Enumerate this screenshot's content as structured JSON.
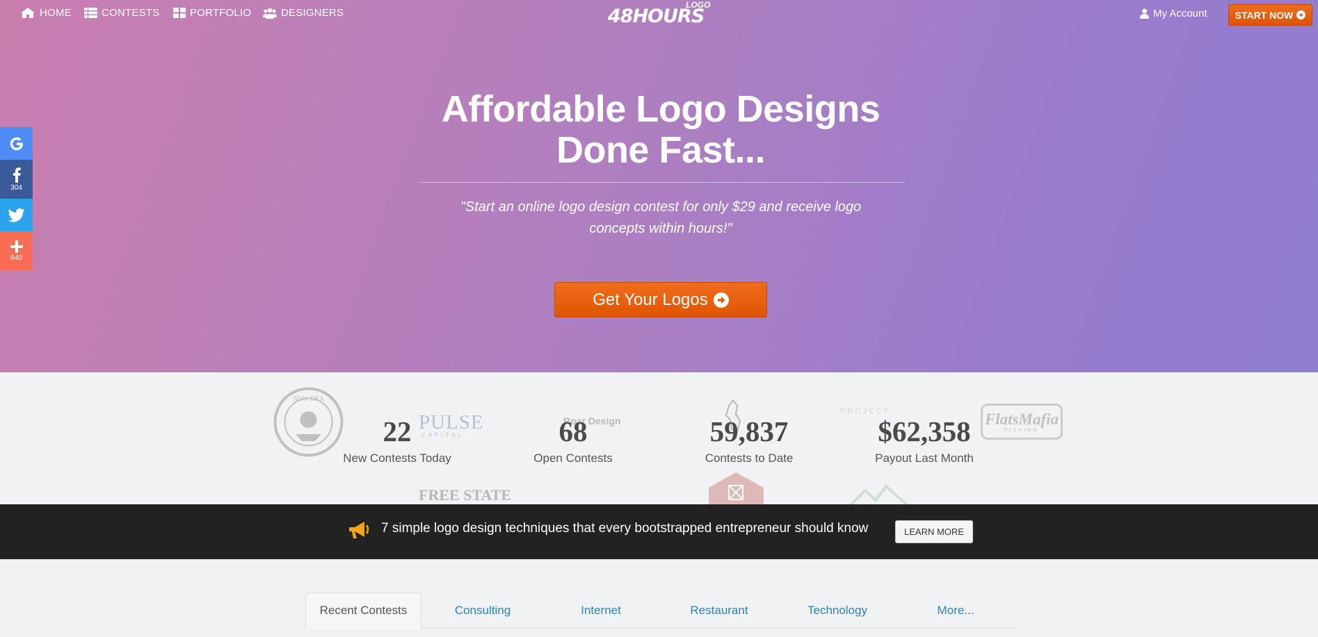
{
  "nav": {
    "items": [
      {
        "label": "HOME",
        "icon": "home-icon"
      },
      {
        "label": "CONTESTS",
        "icon": "list-icon"
      },
      {
        "label": "PORTFOLIO",
        "icon": "grid-icon"
      },
      {
        "label": "DESIGNERS",
        "icon": "users-icon"
      }
    ],
    "logo_text": "48HOURS",
    "logo_tag": "LOGO",
    "account_label": "My Account",
    "start_label": "START NOW"
  },
  "hero": {
    "title_line1": "Affordable Logo Designs",
    "title_line2": "Done Fast...",
    "subtitle": "\"Start an online logo design contest for only $29 and receive logo concepts within hours!\"",
    "cta_label": "Get Your Logos"
  },
  "social": {
    "facebook_count": "304",
    "share_count": "940"
  },
  "stats": [
    {
      "value": "22",
      "label": "New Contests Today"
    },
    {
      "value": "68",
      "label": "Open Contests"
    },
    {
      "value": "59,837",
      "label": "Contests to Date"
    },
    {
      "value": "$62,358",
      "label": "Payout Last Month"
    }
  ],
  "ghost_logos": {
    "pulse": "PULSE",
    "pulse_sub": "CAPITAL",
    "roar": "Roar Design",
    "project": "PROJECT",
    "flats": "FlatsMafia",
    "flats_sub": "FISHING",
    "freestate": "FREE STATE",
    "newera": "NEW ERA"
  },
  "banner": {
    "text": "7 simple logo design techniques that every bootstrapped entrepreneur should know",
    "button_label": "LEARN MORE"
  },
  "tabs": [
    "Recent Contests",
    "Consulting",
    "Internet",
    "Restaurant",
    "Technology",
    "More..."
  ],
  "colors": {
    "accent_orange": "#e85d0c",
    "link_blue": "#2a82b8"
  }
}
